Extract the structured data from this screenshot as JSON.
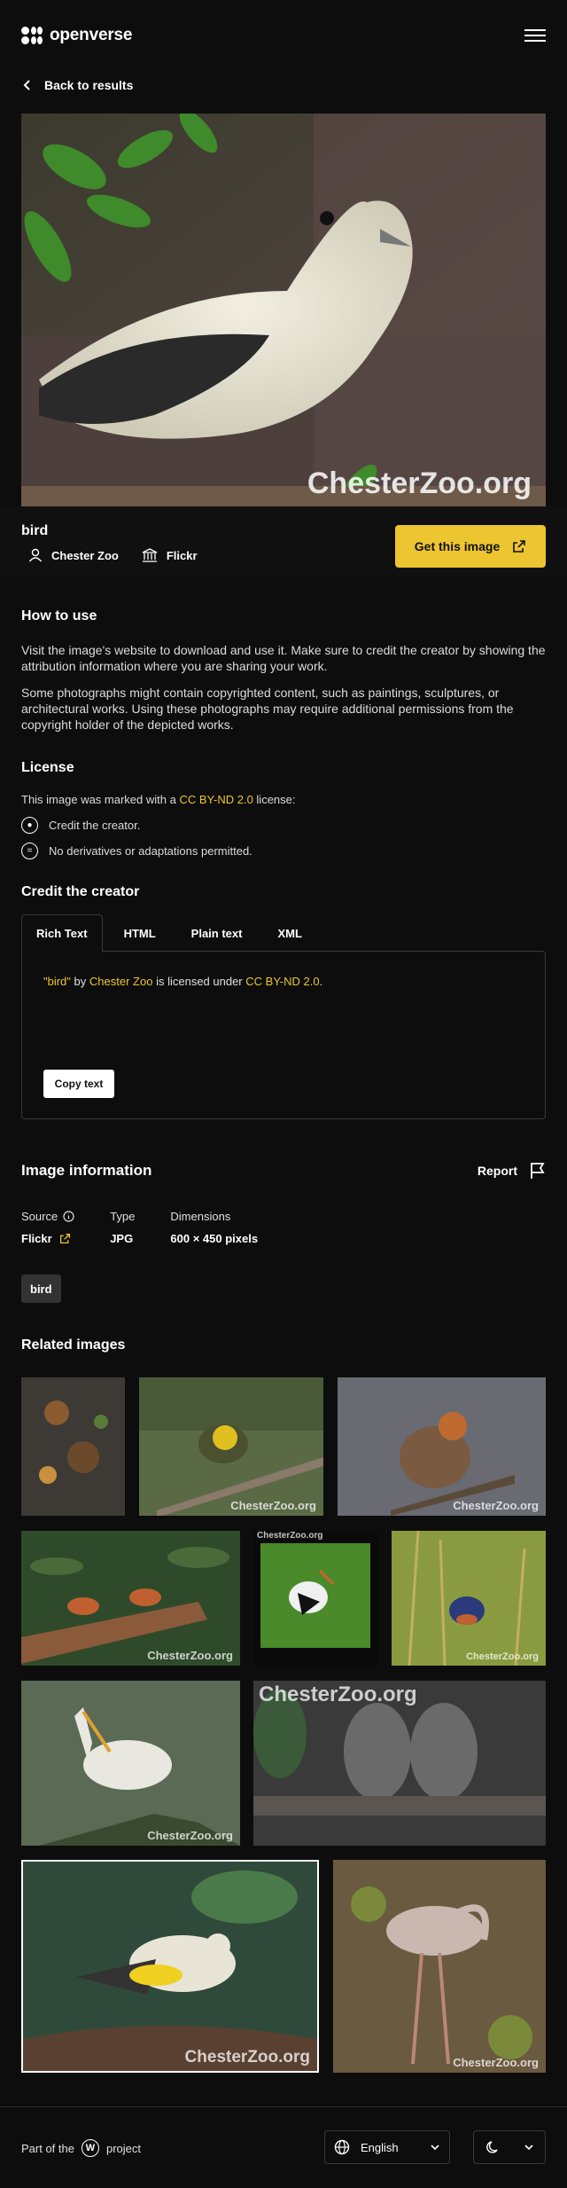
{
  "header": {
    "brand": "openverse",
    "menu_icon": "hamburger-icon"
  },
  "nav": {
    "back_label": "Back to results"
  },
  "image": {
    "title": "bird",
    "creator": "Chester Zoo",
    "source": "Flickr",
    "watermark": "ChesterZoo.org",
    "get_button": "Get this image"
  },
  "how_to_use": {
    "heading": "How to use",
    "p1": "Visit the image's website to download and use it. Make sure to credit the creator by showing the attribution information where you are sharing your work.",
    "p2": "Some photographs might contain copyrighted content, such as paintings, sculptures, or architectural works. Using these photographs may require additional permissions from the copyright holder of the depicted works."
  },
  "license": {
    "heading": "License",
    "intro_before": "This image was marked with a",
    "name": "CC BY-ND 2.0",
    "intro_after": "license:",
    "items": [
      "Credit the creator.",
      "No derivatives or adaptations permitted."
    ]
  },
  "credit": {
    "heading": "Credit the creator",
    "tabs": [
      "Rich Text",
      "HTML",
      "Plain text",
      "XML"
    ],
    "active_tab": "Rich Text",
    "text_title": "\"bird\"",
    "text_by": "by",
    "text_creator": "Chester Zoo",
    "text_mid": "is licensed under",
    "text_license": "CC BY-ND 2.0",
    "text_end": ".",
    "copy_button": "Copy text"
  },
  "info": {
    "heading": "Image information",
    "report_label": "Report",
    "source_label": "Source",
    "source_value": "Flickr",
    "type_label": "Type",
    "type_value": "JPG",
    "dimensions_label": "Dimensions",
    "dimensions_value": "600 × 450 pixels",
    "tags": [
      "bird"
    ]
  },
  "related": {
    "heading": "Related images",
    "watermark": "ChesterZoo.org"
  },
  "footer": {
    "part_of": "Part of the",
    "project": "project",
    "language": "English"
  },
  "colors": {
    "accent": "#ecc530",
    "background": "#0d0d0d"
  }
}
